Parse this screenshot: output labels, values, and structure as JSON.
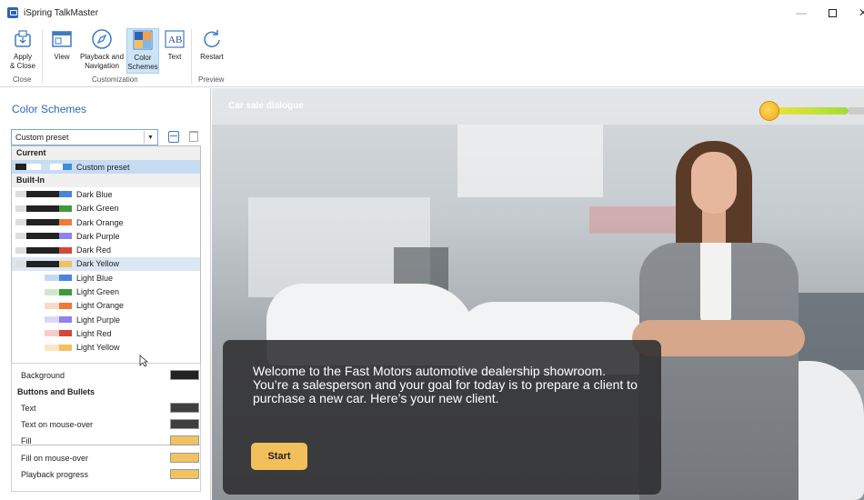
{
  "app": {
    "title": "iSpring TalkMaster"
  },
  "ribbon": {
    "buttons": [
      {
        "label": "Apply\n& Close",
        "icon": "apply-close-icon"
      },
      {
        "label": "View",
        "icon": "view-icon"
      },
      {
        "label": "Playback and\nNavigation",
        "icon": "compass-icon"
      },
      {
        "label": "Color\nSchemes",
        "icon": "color-schemes-icon"
      },
      {
        "label": "Text",
        "icon": "text-ab-icon"
      },
      {
        "label": "Restart",
        "icon": "restart-icon"
      }
    ],
    "groups": [
      "Close",
      "Customization",
      "Preview"
    ]
  },
  "panel": {
    "title": "Color Schemes",
    "preset_selected": "Custom preset",
    "dropdown": {
      "current_header": "Current",
      "current_item": {
        "label": "Custom preset",
        "colors": [
          "#222222",
          "#ffffff",
          "#cfe0f2",
          "#ffffff",
          "#3a8fd8"
        ]
      },
      "builtin_header": "Built-In",
      "items": [
        {
          "label": "Dark Blue",
          "colors": [
            "#dddddd",
            "#222222",
            "#222222",
            "#4a86d8"
          ]
        },
        {
          "label": "Dark Green",
          "colors": [
            "#dddddd",
            "#222222",
            "#222222",
            "#3f9a3a"
          ]
        },
        {
          "label": "Dark Orange",
          "colors": [
            "#dddddd",
            "#222222",
            "#222222",
            "#ee7a3a"
          ]
        },
        {
          "label": "Dark Purple",
          "colors": [
            "#dddddd",
            "#222222",
            "#222222",
            "#8f82ea"
          ]
        },
        {
          "label": "Dark Red",
          "colors": [
            "#dddddd",
            "#222222",
            "#222222",
            "#d6453a"
          ]
        },
        {
          "label": "Dark Yellow",
          "colors": [
            "#dddddd",
            "#222222",
            "#222222",
            "#f2c160"
          ]
        },
        {
          "label": "Light Blue",
          "colors": [
            "#ffffff",
            "#ffffff",
            "#c7d8f3",
            "#4a86d8"
          ]
        },
        {
          "label": "Light Green",
          "colors": [
            "#ffffff",
            "#ffffff",
            "#cfe8cc",
            "#3f9a3a"
          ]
        },
        {
          "label": "Light Orange",
          "colors": [
            "#ffffff",
            "#ffffff",
            "#fadac5",
            "#ee7a3a"
          ]
        },
        {
          "label": "Light Purple",
          "colors": [
            "#ffffff",
            "#ffffff",
            "#dcd7fa",
            "#8f82ea"
          ]
        },
        {
          "label": "Light Red",
          "colors": [
            "#ffffff",
            "#ffffff",
            "#f5cdca",
            "#d6453a"
          ]
        },
        {
          "label": "Light Yellow",
          "colors": [
            "#ffffff",
            "#ffffff",
            "#fbe7c1",
            "#f2c160"
          ]
        }
      ],
      "hovered_item": "Dark Yellow"
    },
    "properties": [
      {
        "label": "Background",
        "color": "#222222",
        "bold": false
      },
      {
        "label": "Buttons and Bullets",
        "color": null,
        "bold": true
      },
      {
        "label": "Text",
        "color": "#3f3f3f",
        "bold": false
      },
      {
        "label": "Text on mouse-over",
        "color": "#3f3f3f",
        "bold": false
      },
      {
        "label": "Fill",
        "color": "#f2c160",
        "bold": false
      },
      {
        "label": "Fill on mouse-over",
        "color": "#f2c160",
        "bold": false
      },
      {
        "label": "Playback progress",
        "color": "#f2c160",
        "bold": false
      }
    ]
  },
  "stage": {
    "title": "Car sale dialogue",
    "dialog_text": "Welcome to the Fast Motors automotive dealership showroom. You’re a salesperson and your goal for today is to prepare a client to purchase a new car. Here’s your new client.",
    "start_label": "Start"
  },
  "colors": {
    "accent": "#2e6aa8",
    "selection": "#c5dcf2",
    "start_button": "#f3bf5b"
  }
}
